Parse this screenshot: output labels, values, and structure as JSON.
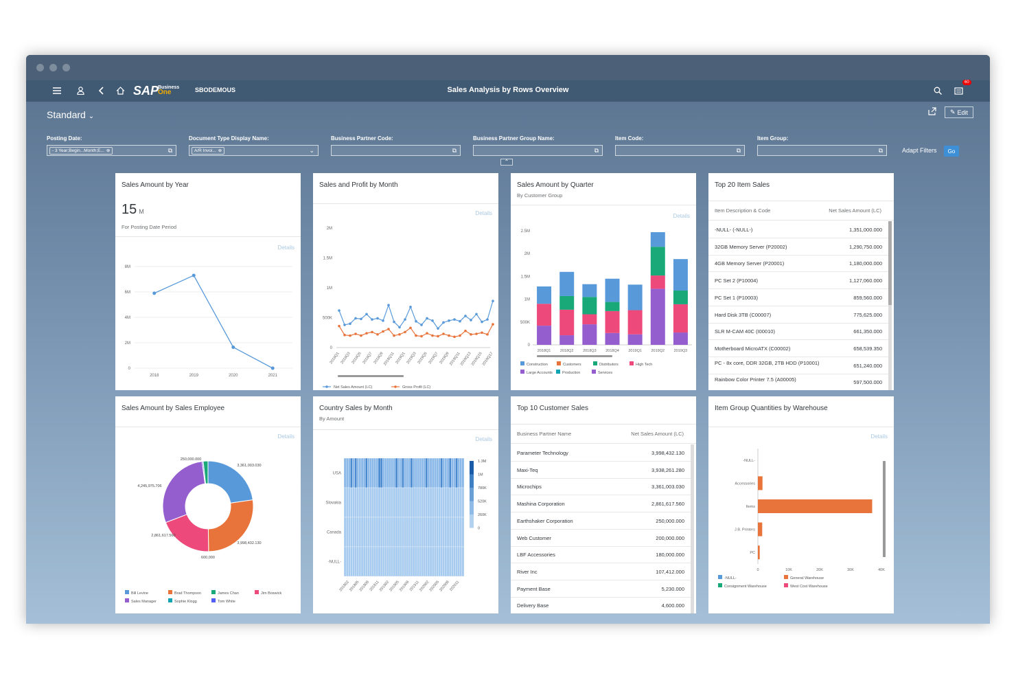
{
  "shell": {
    "company": "SBODEMOUS",
    "title": "Sales Analysis by Rows Overview",
    "logo_text": "SAP",
    "logo_sub1": "Business",
    "logo_sub2": "One",
    "notifications": "60"
  },
  "header": {
    "variant": "Standard",
    "edit_label": "Edit",
    "adapt_filters": "Adapt Filters",
    "go": "Go"
  },
  "filters": [
    {
      "label": "Posting Date:",
      "value": "- 3 Year;Begin...Month;E..."
    },
    {
      "label": "Document Type Display Name:",
      "value": "A/R Invoi..."
    },
    {
      "label": "Business Partner Code:",
      "value": ""
    },
    {
      "label": "Business Partner Group Name:",
      "value": ""
    },
    {
      "label": "Item Code:",
      "value": ""
    },
    {
      "label": "Item Group:",
      "value": ""
    }
  ],
  "details_label": "Details",
  "cards": {
    "sales_by_year": {
      "title": "Sales Amount by Year",
      "kpi": "15",
      "kpi_unit": "M",
      "kpi_sub": "For Posting Date Period"
    },
    "profit_by_month": {
      "title": "Sales and Profit by Month"
    },
    "amount_by_quarter": {
      "title": "Sales Amount by Quarter",
      "subtitle": "By Customer Group"
    },
    "top20": {
      "title": "Top 20 Item Sales",
      "col1": "Item Description & Code",
      "col2": "Net Sales Amount (LC)",
      "rows": [
        {
          "name": "-NULL- (-NULL-)",
          "value": "1,351,000.000"
        },
        {
          "name": "32GB Memory Server (P20002)",
          "value": "1,290,750.000"
        },
        {
          "name": "4GB Memory Server (P20001)",
          "value": "1,180,000.000"
        },
        {
          "name": "PC Set 2 (P10004)",
          "value": "1,127,060.000"
        },
        {
          "name": "PC Set 1 (P10003)",
          "value": "859,560.000"
        },
        {
          "name": "Hard Disk 3TB (C00007)",
          "value": "775,625.000"
        },
        {
          "name": "SLR M-CAM 40C (I00010)",
          "value": "661,350.000"
        },
        {
          "name": "Motherboard MicroATX (C00002)",
          "value": "658,539.350"
        },
        {
          "name": "PC - 8x core, DDR 32GB, 2TB HDD (P10001)",
          "value": "651,240.000"
        },
        {
          "name": "Rainbow Color Printer 7.5 (A00005)",
          "value": "597,500.000"
        }
      ]
    },
    "by_employee": {
      "title": "Sales Amount by Sales Employee"
    },
    "country_by_month": {
      "title": "Country Sales by Month",
      "subtitle": "By Amount"
    },
    "top10": {
      "title": "Top 10 Customer Sales",
      "col1": "Business Partner Name",
      "col2": "Net Sales Amount (LC)",
      "rows": [
        {
          "name": "Parameter Technology",
          "value": "3,998,432.130"
        },
        {
          "name": "Maxi-Teq",
          "value": "3,938,261.280"
        },
        {
          "name": "Microchips",
          "value": "3,361,003.030"
        },
        {
          "name": "Mashina Corporation",
          "value": "2,861,617.560"
        },
        {
          "name": "Earthshaker Corporation",
          "value": "250,000.000"
        },
        {
          "name": "Web Customer",
          "value": "200,000.000"
        },
        {
          "name": "LBF Accessories",
          "value": "180,000.000"
        },
        {
          "name": "River Inc",
          "value": "107,412.000"
        },
        {
          "name": "Payment Base",
          "value": "5,230.000"
        },
        {
          "name": "Delivery Base",
          "value": "4,600.000"
        }
      ]
    },
    "by_warehouse": {
      "title": "Item Group Quantities by Warehouse"
    }
  },
  "chart_data": [
    {
      "type": "line",
      "title": "Sales Amount by Year",
      "categories": [
        "2018",
        "2019",
        "2020",
        "2021"
      ],
      "y_ticks": [
        "0",
        "2M",
        "4M",
        "6M",
        "8M"
      ],
      "ylim": [
        0,
        8000000
      ],
      "series": [
        {
          "values": [
            5900000,
            7300000,
            1650000,
            0
          ],
          "color": "#5899da"
        }
      ]
    },
    {
      "type": "line",
      "title": "Sales and Profit by Month",
      "categories": [
        "2018Q1",
        "2018Q2",
        "2018Q3",
        "2018Q4",
        "2018Q5",
        "2018Q6",
        "2018Q7",
        "2018Q8",
        "2018Q9",
        "2018Q10",
        "2018Q11",
        "2018Q12",
        "2019Q1",
        "2019Q2",
        "2019Q3",
        "2019Q4",
        "2019Q5",
        "2019Q6",
        "2019Q7",
        "2019Q8",
        "2019Q9",
        "2019Q10",
        "2019Q11",
        "2019Q12",
        "2019Q13",
        "2019Q14",
        "2019Q15",
        "2019Q16",
        "2019Q17"
      ],
      "tick_labels": [
        "2018Q1",
        "2018Q2",
        "2018Q3",
        "2018Q4",
        "2018Q5",
        "2018Q6",
        "2018Q7",
        "2018Q8",
        "2018Q9",
        "2018Q10",
        "2018Q11",
        "2018Q12",
        "2019Q1",
        "2019Q2",
        "2019Q3",
        "2019Q4",
        "2019Q5",
        "2019Q6",
        "2019Q7",
        "2019Q8",
        "2019Q9",
        "2019Q10",
        "2019Q11",
        "2019Q12",
        "2019Q13",
        "2019Q14",
        "2019Q15",
        "2019Q16",
        "2019Q17"
      ],
      "y_ticks": [
        "0",
        "500K",
        "1M",
        "1.5M",
        "2M"
      ],
      "ylim": [
        0,
        2000000
      ],
      "series": [
        {
          "name": "Net Sales Amount (LC)",
          "color": "#5899da",
          "values": [
            620000,
            380000,
            400000,
            490000,
            480000,
            560000,
            470000,
            490000,
            450000,
            710000,
            430000,
            340000,
            470000,
            680000,
            440000,
            380000,
            490000,
            450000,
            320000,
            420000,
            450000,
            470000,
            440000,
            530000,
            460000,
            560000,
            430000,
            470000,
            780000
          ]
        },
        {
          "name": "Gross Profit (LC)",
          "color": "#e8743b",
          "values": [
            360000,
            210000,
            200000,
            230000,
            200000,
            240000,
            260000,
            220000,
            270000,
            310000,
            200000,
            220000,
            260000,
            330000,
            200000,
            190000,
            240000,
            200000,
            190000,
            230000,
            200000,
            180000,
            200000,
            280000,
            220000,
            230000,
            250000,
            220000,
            390000
          ]
        }
      ]
    },
    {
      "type": "bar",
      "stacked": true,
      "title": "Sales Amount by Quarter",
      "categories": [
        "2018Q1",
        "2018Q2",
        "2018Q3",
        "2018Q4",
        "2019Q1",
        "2019Q2",
        "2019Q3"
      ],
      "y_ticks": [
        "0",
        "500K",
        "1M",
        "1.5M",
        "2M",
        "2.5M"
      ],
      "ylim": [
        0,
        2500000
      ],
      "series": [
        {
          "name": "Services",
          "color": "#945ecf",
          "values": [
            0,
            0,
            0,
            0,
            0,
            0,
            0
          ]
        },
        {
          "name": "Large Accounts",
          "color": "#945ecf",
          "values": [
            420000,
            210000,
            450000,
            260000,
            230000,
            1230000,
            270000
          ]
        },
        {
          "name": "High Tech",
          "color": "#ed4a7b",
          "values": [
            480000,
            560000,
            220000,
            480000,
            530000,
            290000,
            620000
          ]
        },
        {
          "name": "Distributors",
          "color": "#19a979",
          "values": [
            0,
            300000,
            380000,
            200000,
            0,
            630000,
            300000
          ]
        },
        {
          "name": "Construction",
          "color": "#5899da",
          "values": [
            380000,
            530000,
            280000,
            510000,
            560000,
            320000,
            690000
          ]
        },
        {
          "name": "Customers",
          "color": "#e8743b",
          "values": [
            0,
            0,
            0,
            0,
            0,
            0,
            0
          ]
        },
        {
          "name": "Production",
          "color": "#13a4b4",
          "values": [
            0,
            0,
            0,
            0,
            0,
            0,
            0
          ]
        }
      ],
      "legend": [
        "Construction",
        "Customers",
        "Distributors",
        "High Tech",
        "Large Accounts",
        "Production",
        "Services"
      ]
    },
    {
      "type": "pie",
      "title": "Sales Amount by Sales Employee",
      "slices": [
        {
          "label": "3,361,003.030",
          "value": 3361003.03,
          "color": "#5899da",
          "name": "Bill Levine"
        },
        {
          "label": "3,998,432.130",
          "value": 3998432.13,
          "color": "#e8743b",
          "name": "Brad Thompson"
        },
        {
          "label": "600,000",
          "value": 0,
          "color": "#13a4b4",
          "name": "Sophie Klogg"
        },
        {
          "label": "2,861,617.560",
          "value": 2861617.56,
          "color": "#ed4a7b",
          "name": "Jim Boswick"
        },
        {
          "label": "4,245,975.706",
          "value": 4245975.706,
          "color": "#945ecf",
          "name": "Sales Manager"
        },
        {
          "label": "",
          "value": 60000,
          "color": "#525df4",
          "name": "Tom White"
        },
        {
          "label": "250,000.000",
          "value": 250000,
          "color": "#19a979",
          "name": "James Chan"
        }
      ],
      "legend": [
        "Bill Levine",
        "Brad Thompson",
        "James Chan",
        "Jim Boswick",
        "Sales Manager",
        "Sophie Klogg",
        "Tom White"
      ]
    },
    {
      "type": "heatmap",
      "title": "Country Sales by Month",
      "rows": [
        "USA",
        "Slovakia",
        "Canada",
        "-NULL-"
      ],
      "columns": [
        "201802",
        "201805",
        "201808",
        "201811",
        "201902",
        "201905",
        "201908",
        "201911",
        "202002",
        "202005",
        "202008",
        "202011"
      ],
      "legend_scale": [
        "1.3M",
        "1M",
        "780K",
        "520K",
        "260K",
        "0"
      ]
    },
    {
      "type": "bar",
      "orientation": "horizontal",
      "title": "Item Group Quantities by Warehouse",
      "categories": [
        "-NULL-",
        "Accessories",
        "Items",
        "J.B. Printers",
        "PC"
      ],
      "x_ticks": [
        "0",
        "10K",
        "20K",
        "30K",
        "40K"
      ],
      "xlim": [
        0,
        40000
      ],
      "series": [
        {
          "name": "General Warehouse",
          "color": "#e8743b",
          "values": [
            0,
            1500,
            37000,
            1400,
            600
          ]
        },
        {
          "name": "-NULL-",
          "color": "#5899da",
          "values": [
            0,
            0,
            0,
            0,
            0
          ]
        },
        {
          "name": "Consignment Warehouse",
          "color": "#19a979",
          "values": [
            0,
            0,
            0,
            0,
            0
          ]
        },
        {
          "name": "West Cost Warehouse",
          "color": "#ed4a7b",
          "values": [
            0,
            0,
            0,
            0,
            0
          ]
        }
      ],
      "legend": [
        "-NULL-",
        "General Warehouse",
        "Consignment Warehouse",
        "West Cost Warehouse"
      ]
    }
  ]
}
